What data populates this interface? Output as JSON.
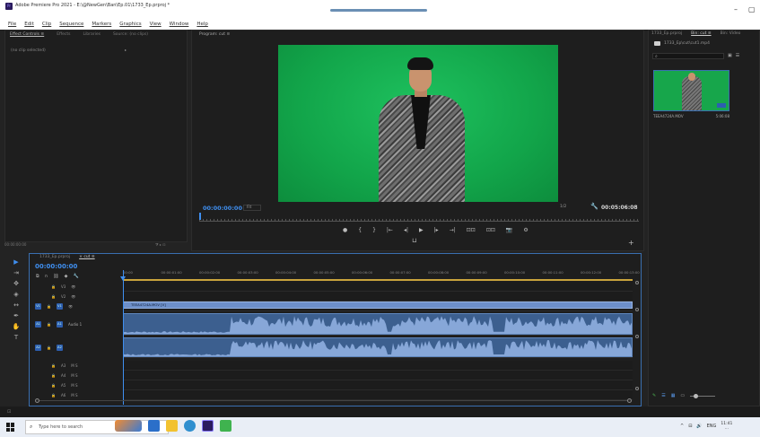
{
  "window": {
    "title": "Adobe Premiere Pro 2021 - E:\\@NewGen\\Ban\\Ep.01\\1733_Ep.prproj *",
    "minimize_glyph": "–",
    "maximize_glyph": "▢"
  },
  "menu": [
    "File",
    "Edit",
    "Clip",
    "Sequence",
    "Markers",
    "Graphics",
    "View",
    "Window",
    "Help"
  ],
  "effect_controls": {
    "tabs": [
      "Effect Controls ≡",
      "Effects",
      "Libraries",
      "Source: (no clips)"
    ],
    "empty_text": "(no clip selected)",
    "arrow": "▸",
    "footer_time": "00:00:00:00"
  },
  "program_monitor": {
    "tab": "Program: cut ≡",
    "timecode": "00:00:00:00",
    "fit": "Fit",
    "resolution": "1/2",
    "duration": "00:05:06:08",
    "transport": [
      "●",
      "{",
      "}",
      "|←",
      "◂|",
      "▶",
      "|▸",
      "→|",
      "⊡⊡",
      "⊡⊡",
      "📷",
      "⚙"
    ],
    "add_button": "+",
    "safe_icon": "⊔"
  },
  "project": {
    "tabs": [
      "1733_Ep.prproj",
      "Bin: cut ≡",
      "Bin: Video"
    ],
    "bin_path": "1733_Ep\\cut\\cut1.mp4",
    "search_placeholder": "",
    "clip_name": "TEEA4724A.MOV",
    "clip_duration": "5:06:08",
    "footer_icons": [
      "✎",
      "☰",
      "▦",
      "▭"
    ]
  },
  "timeline": {
    "tabs": [
      "1733_Ep.prproj",
      "× cut ≡"
    ],
    "timecode": "00:00:00:00",
    "ruler_labels": [
      "00:00",
      "00:00:01:00",
      "00:00:02:00",
      "00:00:03:00",
      "00:00:04:00",
      "00:00:05:00",
      "00:00:06:00",
      "00:00:07:00",
      "00:00:08:00",
      "00:00:09:00",
      "00:00:10:00",
      "00:00:11:00",
      "00:00:12:00",
      "00:00:13:00"
    ],
    "video_tracks": [
      "V3",
      "V2",
      "V1"
    ],
    "audio_tracks": [
      "A1",
      "A2",
      "A3",
      "A4",
      "A5",
      "A6"
    ],
    "video_clip_name": "TEEA4724A.MOV [V]",
    "audio_track_label": "Audio 1",
    "audio_levels_db": [
      "0",
      "-6",
      "-12",
      "-18",
      "-24",
      "-30",
      "-36",
      "-42",
      "-48",
      "-54",
      "dB"
    ]
  },
  "tools": [
    "▶",
    "⇥",
    "✥",
    "◈",
    "↔",
    "✒",
    "✋",
    "T"
  ],
  "taskbar": {
    "search_placeholder": "Type here to search",
    "tray_language": "ENG",
    "time": "11:41",
    "date": "..."
  },
  "colors": {
    "accent_blue": "#3f8ff0",
    "green_screen": "#13a348",
    "clip_blue": "#6d8fc9",
    "audio_clip": "#3c5f8f"
  }
}
